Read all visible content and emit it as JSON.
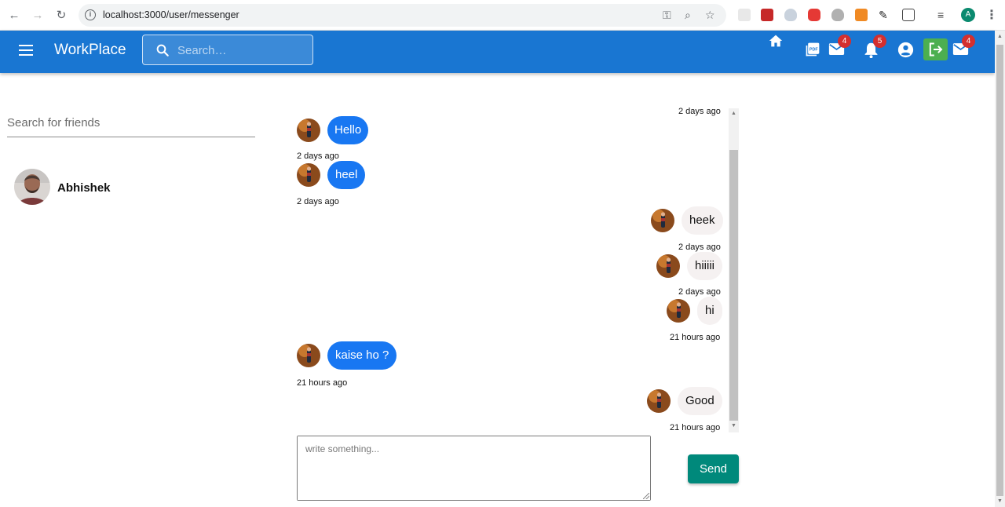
{
  "browser": {
    "url": "localhost:3000/user/messenger",
    "profile_initial": "A"
  },
  "appbar": {
    "title": "WorkPlace",
    "search_placeholder": "Search…",
    "mail_badge": "4",
    "notifications_badge": "5",
    "mail2_badge": "4"
  },
  "sidebar": {
    "search_placeholder": "Search for friends",
    "friends": [
      {
        "name": "Abhishek"
      }
    ]
  },
  "chat": {
    "messages": [
      {
        "text": "Hello",
        "from": "own",
        "time": "2 days ago"
      },
      {
        "text": "heel",
        "from": "own",
        "time": "2 days ago"
      },
      {
        "text": "heek",
        "from": "other",
        "time": "2 days ago"
      },
      {
        "text": "hiiiii",
        "from": "other",
        "time": "2 days ago"
      },
      {
        "text": "hi",
        "from": "other",
        "time": "21 hours ago"
      },
      {
        "text": "kaise ho ?",
        "from": "own",
        "time": "21 hours ago"
      },
      {
        "text": "Good",
        "from": "other",
        "time": "21 hours ago"
      }
    ],
    "top_time": "2 days ago",
    "compose_placeholder": "write something...",
    "send_label": "Send"
  },
  "colors": {
    "appbar": "#1976d2",
    "own_bubble": "#1877f2",
    "other_bubble": "#f5f1f1",
    "send_button": "#00897b",
    "badge": "#d32f2f",
    "logout": "#4caf50"
  }
}
